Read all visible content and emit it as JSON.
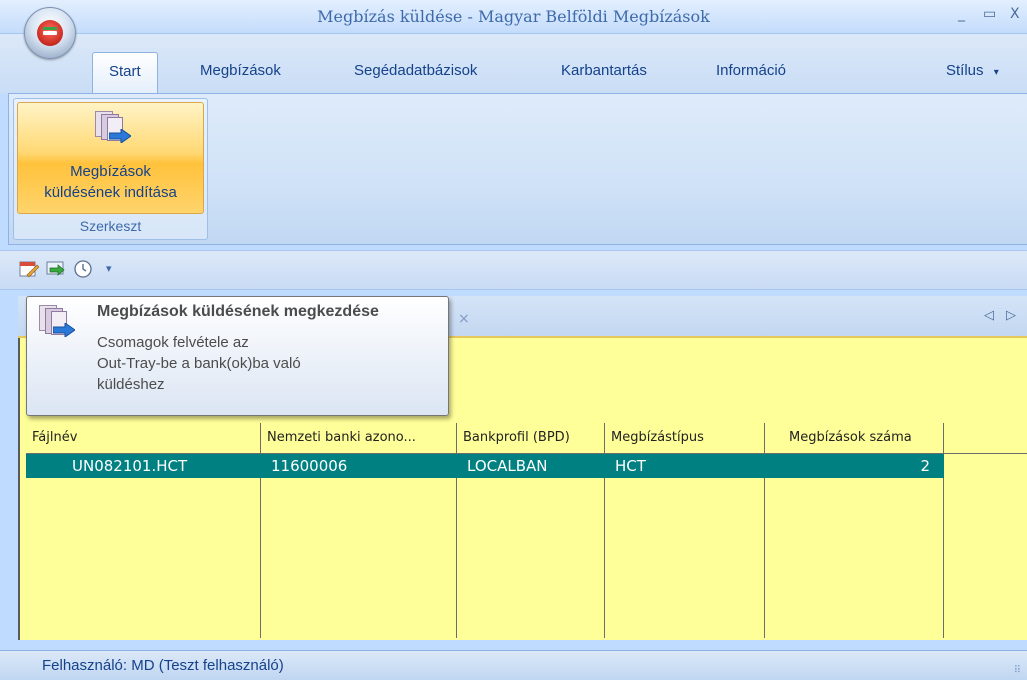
{
  "window": {
    "title": "Megbízás küldése - Magyar Belföldi Megbízások",
    "minimize": "_",
    "maximize": "▭",
    "close": "X"
  },
  "tabs": [
    {
      "label": "Start",
      "active": true
    },
    {
      "label": "Megbízások"
    },
    {
      "label": "Segédadatbázisok"
    },
    {
      "label": "Karbantartás"
    },
    {
      "label": "Információ"
    }
  ],
  "style_menu": {
    "label": "Stílus",
    "arrow": "▾"
  },
  "ribbon": {
    "big_button_line1": "Megbízások",
    "big_button_line2": "küldésének indítása",
    "group_label": "Szerkeszt"
  },
  "qat": {
    "dropdown": "▾"
  },
  "doc_tab": {
    "close": "×",
    "nav_prev": "◁",
    "nav_next": "▷"
  },
  "tooltip": {
    "title": "Megbízások küldésének megkezdése",
    "body_line1": "Csomagok felvétele az",
    "body_line2": "Out-Tray-be a bank(ok)ba való",
    "body_line3": "küldéshez"
  },
  "grid": {
    "columns": [
      "Fájlnév",
      "Nemzeti banki azono...",
      "Bankprofil (BPD)",
      "Megbízástípus",
      "Megbízások száma"
    ],
    "rows": [
      {
        "file": "UN082101.HCT",
        "bank_id": "11600006",
        "profile": "LOCALBAN",
        "type": "HCT",
        "count": "2"
      }
    ]
  },
  "status": {
    "user": "Felhasználó: MD (Teszt felhasználó)",
    "grip": "⠿"
  },
  "colors": {
    "selection": "#008080",
    "content_bg": "#ffff99",
    "ribbon_accent": "#ffc23c"
  }
}
